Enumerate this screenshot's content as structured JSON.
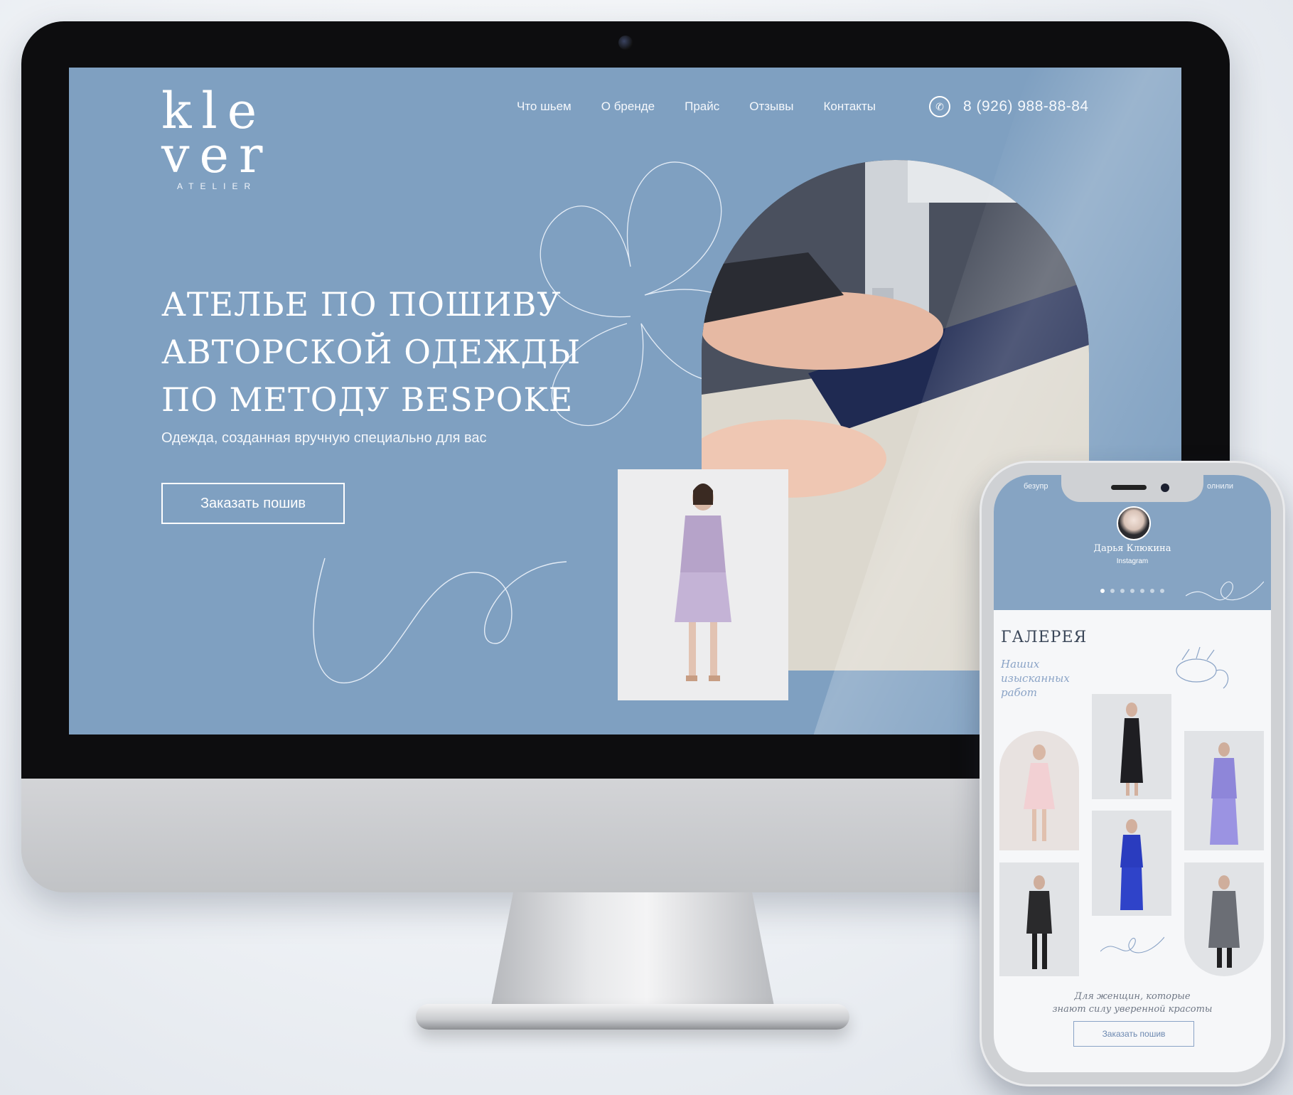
{
  "site": {
    "logo": {
      "line1": "kle",
      "line2": "ver",
      "sub": "ATELIER"
    },
    "nav": [
      "Что шьем",
      "О бренде",
      "Прайс",
      "Отзывы",
      "Контакты"
    ],
    "phone": "8 (926) 988-88-84",
    "hero": {
      "title_lines": [
        "АТЕЛЬЕ ПО ПОШИВУ",
        "АВТОРСКОЙ ОДЕЖДЫ",
        "ПО МЕТОДУ BESPOKE"
      ],
      "subtitle": "Одежда, созданная вручную специально для вас",
      "cta": "Заказать пошив"
    }
  },
  "mobile": {
    "top_left_text": "безупр",
    "top_right_text": "олнили",
    "review_name": "Дарья Клюкина",
    "review_source": "Instagram",
    "slider_dots": 7,
    "slider_active": 0,
    "gallery_title": "ГАЛЕРЕЯ",
    "gallery_subtitle": "Наших изысканных работ",
    "footer_lines": [
      "Для женщин, которые",
      "знают силу уверенной красоты"
    ],
    "cta": "Заказать пошив"
  },
  "colors": {
    "screen_bg": "#7fa0c1",
    "mobile_header_bg": "#86a4c3",
    "accent": "#8aa3c6",
    "white": "#ffffff"
  },
  "icons": [
    "whatsapp-icon"
  ]
}
